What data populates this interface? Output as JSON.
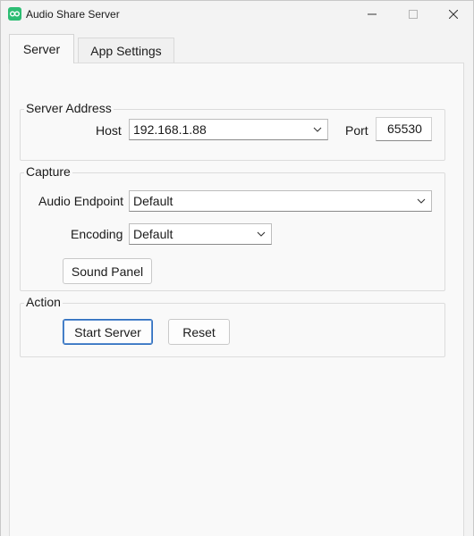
{
  "window": {
    "title": "Audio Share Server"
  },
  "tabs": [
    {
      "label": "Server",
      "selected": true
    },
    {
      "label": "App Settings",
      "selected": false
    }
  ],
  "server_address": {
    "group_label": "Server Address",
    "host_label": "Host",
    "host_value": "192.168.1.88",
    "port_label": "Port",
    "port_value": "65530"
  },
  "capture": {
    "group_label": "Capture",
    "endpoint_label": "Audio Endpoint",
    "endpoint_value": "Default",
    "encoding_label": "Encoding",
    "encoding_value": "Default",
    "sound_panel_label": "Sound Panel"
  },
  "action": {
    "group_label": "Action",
    "start_label": "Start Server",
    "reset_label": "Reset"
  },
  "colors": {
    "app_icon": "#2dbd73",
    "primary_border": "#2f6fbf"
  },
  "icons": {
    "app": "app-share-icon",
    "minimize": "minimize-icon",
    "maximize": "maximize-icon",
    "close": "close-icon",
    "dropdown": "chevron-down-icon"
  }
}
